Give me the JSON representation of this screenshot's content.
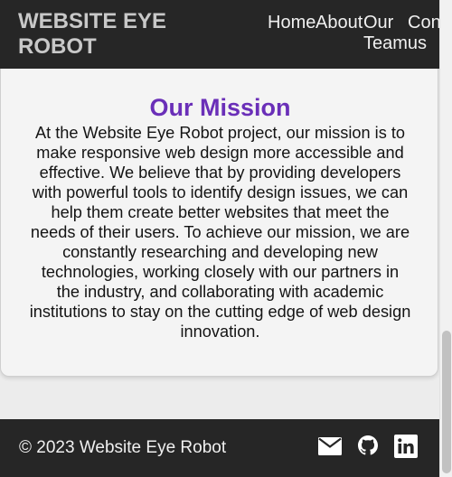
{
  "header": {
    "brand": "WEBSITE EYE ROBOT",
    "nav": {
      "home": "Home",
      "about": "About",
      "our": "Our",
      "team": "Teamus",
      "contact": "Contact"
    }
  },
  "mission": {
    "title": "Our Mission",
    "text": "At the Website Eye Robot project, our mission is to make responsive web design more accessible and effective. We believe that by providing developers with powerful tools to identify design issues, we can help them create better websites that meet the needs of their users. To achieve our mission, we are constantly researching and developing new technologies, working closely with our partners in the industry, and collaborating with academic institutions to stay on the cutting edge of web design innovation."
  },
  "footer": {
    "copyright": "© 2023 Website Eye Robot",
    "icons": [
      "mail-icon",
      "github-icon",
      "linkedin-icon"
    ]
  },
  "colors": {
    "header_bg": "#262626",
    "brand_text": "#c8c8c8",
    "mission_title": "#6a2fb8",
    "page_bg": "#ececec"
  }
}
